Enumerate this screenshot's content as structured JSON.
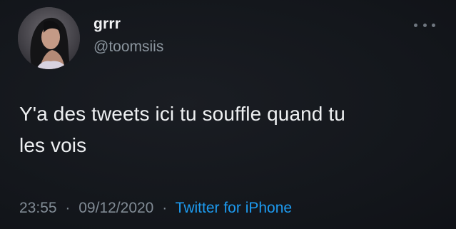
{
  "user": {
    "display_name": "grrr",
    "handle": "@toomsiis"
  },
  "tweet": {
    "text_line1": "Y'a des tweets ici tu souffle quand tu",
    "text_line2": "les vois",
    "time": "23:55",
    "separator": "·",
    "date": "09/12/2020",
    "source": "Twitter for iPhone"
  },
  "icons": {
    "more": "more-horizontal-icon"
  },
  "colors": {
    "background": "#15181d",
    "text": "#eef0f2",
    "secondary": "#818b95",
    "link": "#1d9bf0"
  }
}
